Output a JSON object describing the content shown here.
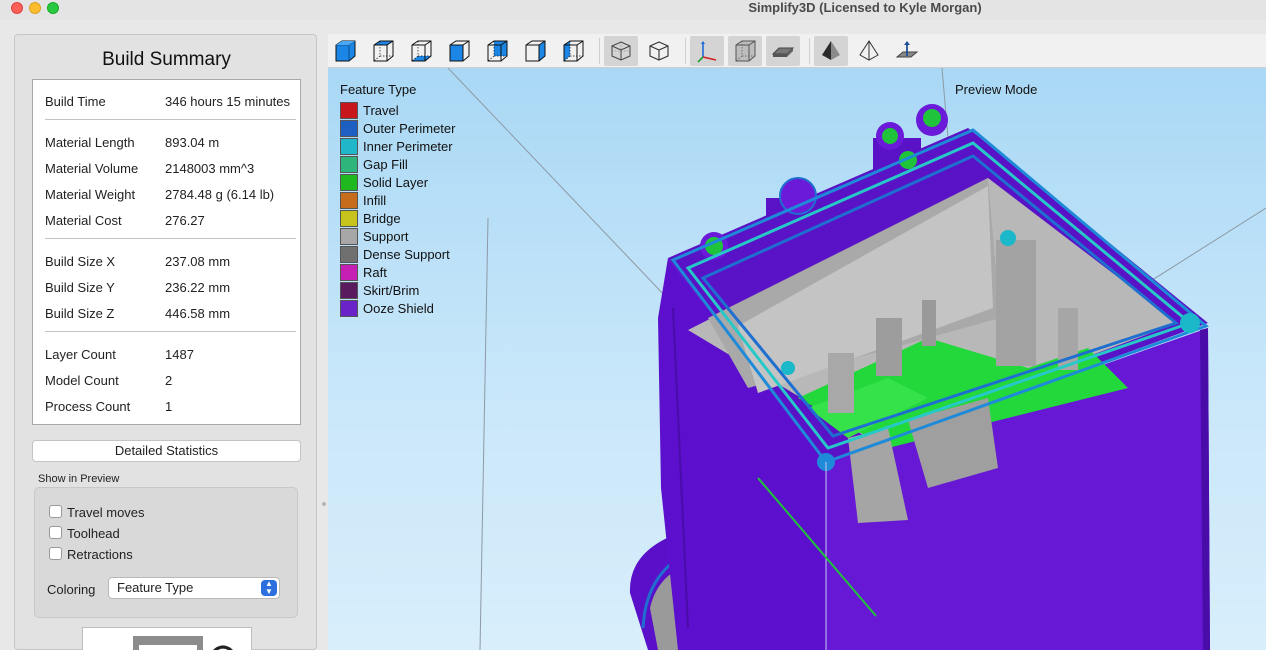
{
  "window": {
    "title": "Simplify3D (Licensed to Kyle Morgan)"
  },
  "build_summary": {
    "title": "Build Summary",
    "rows": [
      {
        "label": "Build Time",
        "value": "346 hours 15 minutes"
      },
      {
        "label": "Material Length",
        "value": "893.04 m"
      },
      {
        "label": "Material Volume",
        "value": "2148003 mm^3"
      },
      {
        "label": "Material Weight",
        "value": "2784.48 g (6.14 lb)"
      },
      {
        "label": "Material Cost",
        "value": "276.27"
      },
      {
        "label": "Build Size X",
        "value": "237.08 mm"
      },
      {
        "label": "Build Size Y",
        "value": "236.22 mm"
      },
      {
        "label": "Build Size Z",
        "value": "446.58 mm"
      },
      {
        "label": "Layer Count",
        "value": "1487"
      },
      {
        "label": "Model Count",
        "value": "2"
      },
      {
        "label": "Process Count",
        "value": "1"
      }
    ],
    "detailed_button": "Detailed Statistics"
  },
  "show_in_preview": {
    "title": "Show in Preview",
    "options": [
      {
        "label": "Travel moves",
        "checked": false
      },
      {
        "label": "Toolhead",
        "checked": false
      },
      {
        "label": "Retractions",
        "checked": false
      }
    ],
    "coloring_label": "Coloring",
    "coloring_value": "Feature Type"
  },
  "toolbar": {
    "buttons": [
      {
        "name": "view-iso-button",
        "icon": "cube-iso-icon"
      },
      {
        "name": "view-top-button",
        "icon": "cube-top-icon"
      },
      {
        "name": "view-bottom-button",
        "icon": "cube-bottom-icon"
      },
      {
        "name": "view-front-button",
        "icon": "cube-front-icon"
      },
      {
        "name": "view-back-button",
        "icon": "cube-back-icon"
      },
      {
        "name": "view-left-button",
        "icon": "cube-left-icon"
      },
      {
        "name": "view-right-button",
        "icon": "cube-right-icon"
      },
      {
        "name": "perspective-toggle-button",
        "icon": "perspective-cube-icon"
      },
      {
        "name": "orthographic-toggle-button",
        "icon": "ortho-cube-icon"
      },
      {
        "name": "axes-toggle-button",
        "icon": "axes-icon"
      },
      {
        "name": "build-volume-toggle-button",
        "icon": "build-volume-icon"
      },
      {
        "name": "bed-toggle-button",
        "icon": "bed-icon"
      },
      {
        "name": "shaded-mode-button",
        "icon": "shaded-pyramid-icon"
      },
      {
        "name": "wireframe-mode-button",
        "icon": "wire-pyramid-icon"
      },
      {
        "name": "cross-section-button",
        "icon": "section-arrow-icon"
      }
    ]
  },
  "viewport": {
    "legend_title": "Feature Type",
    "preview_mode_label": "Preview Mode",
    "legend": [
      {
        "label": "Travel",
        "color": "#c8161d"
      },
      {
        "label": "Outer Perimeter",
        "color": "#1e5fc4"
      },
      {
        "label": "Inner Perimeter",
        "color": "#1fb7c9"
      },
      {
        "label": "Gap Fill",
        "color": "#2db57c"
      },
      {
        "label": "Solid Layer",
        "color": "#1fb81f"
      },
      {
        "label": "Infill",
        "color": "#c76b1c"
      },
      {
        "label": "Bridge",
        "color": "#c6c31c"
      },
      {
        "label": "Support",
        "color": "#a7a7a7"
      },
      {
        "label": "Dense Support",
        "color": "#707070"
      },
      {
        "label": "Raft",
        "color": "#c51fb3"
      },
      {
        "label": "Skirt/Brim",
        "color": "#5a1a5e"
      },
      {
        "label": "Ooze Shield",
        "color": "#6a22c9"
      }
    ]
  }
}
